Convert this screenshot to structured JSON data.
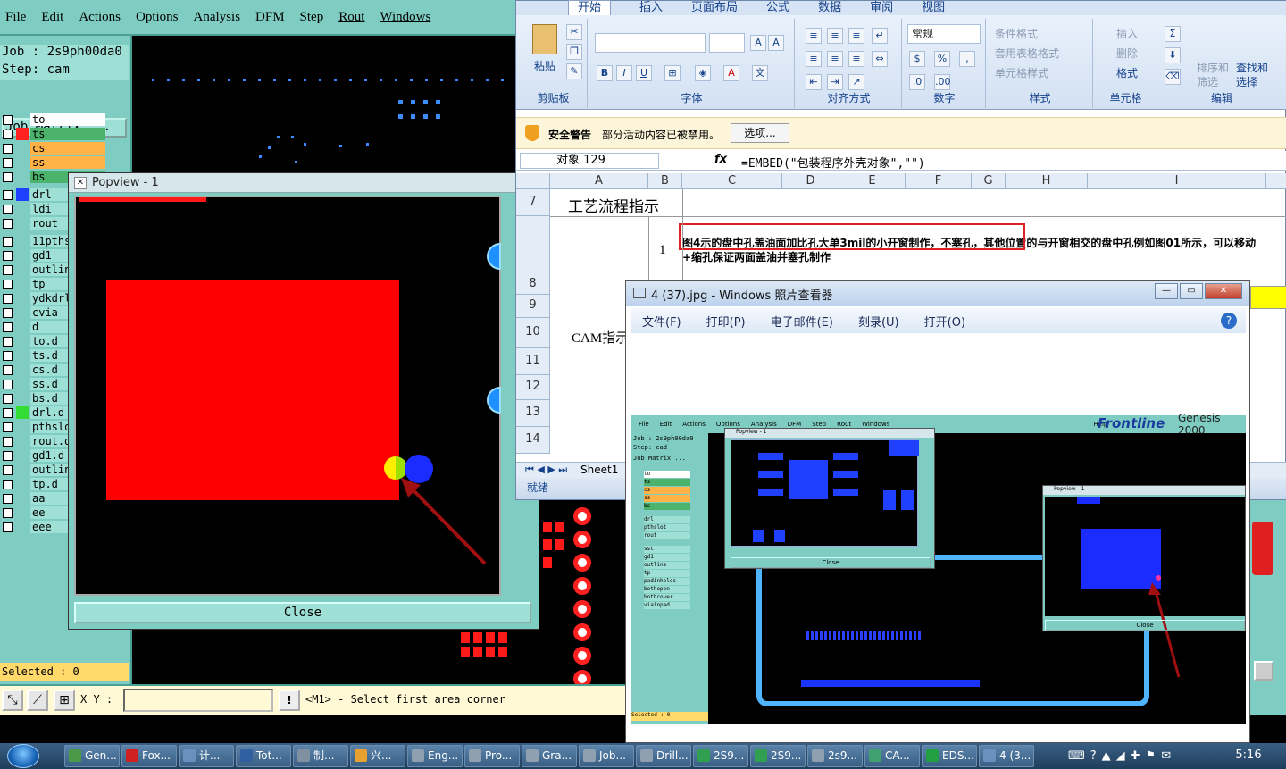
{
  "genesis": {
    "menu": [
      "File",
      "Edit",
      "Actions",
      "Options",
      "Analysis",
      "DFM",
      "Step",
      "Rout",
      "Windows"
    ],
    "job": "Job : 2s9ph00da0",
    "step": "Step: cam",
    "job_matrix": "Job Matrix ...",
    "layers": [
      {
        "name": "to",
        "color": "#ffffff",
        "swatch": ""
      },
      {
        "name": "ts",
        "color": "#4bb36b",
        "swatch": "#ff2020"
      },
      {
        "name": "cs",
        "color": "#ffb347",
        "swatch": ""
      },
      {
        "name": "ss",
        "color": "#ffb347",
        "swatch": ""
      },
      {
        "name": "bs",
        "color": "#4bb36b",
        "swatch": ""
      },
      {
        "name": "drl",
        "color": "#9fe0d6",
        "swatch": "#2040ff"
      },
      {
        "name": "ldi",
        "color": "#9fe0d6",
        "swatch": ""
      },
      {
        "name": "rout",
        "color": "#9fe0d6",
        "swatch": ""
      },
      {
        "name": "11pths",
        "color": "#9fe0d6",
        "swatch": ""
      },
      {
        "name": "gd1",
        "color": "#9fe0d6",
        "swatch": ""
      },
      {
        "name": "outlin",
        "color": "#9fe0d6",
        "swatch": ""
      },
      {
        "name": "tp",
        "color": "#9fe0d6",
        "swatch": ""
      },
      {
        "name": "ydkdrl",
        "color": "#9fe0d6",
        "swatch": ""
      },
      {
        "name": "cvia",
        "color": "#9fe0d6",
        "swatch": ""
      },
      {
        "name": "d",
        "color": "#9fe0d6",
        "swatch": ""
      },
      {
        "name": "to.d",
        "color": "#9fe0d6",
        "swatch": ""
      },
      {
        "name": "ts.d",
        "color": "#9fe0d6",
        "swatch": ""
      },
      {
        "name": "cs.d",
        "color": "#9fe0d6",
        "swatch": ""
      },
      {
        "name": "ss.d",
        "color": "#9fe0d6",
        "swatch": ""
      },
      {
        "name": "bs.d",
        "color": "#9fe0d6",
        "swatch": ""
      },
      {
        "name": "drl.d",
        "color": "#9fe0d6",
        "swatch": "#33dd33"
      },
      {
        "name": "pthslo",
        "color": "#9fe0d6",
        "swatch": ""
      },
      {
        "name": "rout.d",
        "color": "#9fe0d6",
        "swatch": ""
      },
      {
        "name": "gd1.d",
        "color": "#9fe0d6",
        "swatch": ""
      },
      {
        "name": "outlin",
        "color": "#9fe0d6",
        "swatch": ""
      },
      {
        "name": "tp.d",
        "color": "#9fe0d6",
        "swatch": ""
      },
      {
        "name": "aa",
        "color": "#9fe0d6",
        "swatch": ""
      },
      {
        "name": "ee",
        "color": "#9fe0d6",
        "swatch": ""
      },
      {
        "name": "eee",
        "color": "#9fe0d6",
        "swatch": ""
      }
    ],
    "selected": "Selected : 0",
    "xy_label": "X Y :",
    "xy_value": "",
    "prompt": "<M1> - Select first area corner"
  },
  "popview": {
    "title": "Popview - 1",
    "close": "Close"
  },
  "excel": {
    "tabs": [
      "开始",
      "插入",
      "页面布局",
      "公式",
      "数据",
      "审阅",
      "视图"
    ],
    "groups": {
      "clipboard": "剪贴板",
      "paste": "粘贴",
      "font": "字体",
      "align": "对齐方式",
      "number": "数字",
      "number_format": "常规",
      "styles": "样式",
      "cond_format": "条件格式",
      "table_format": "套用表格格式",
      "cell_style": "单元格样式",
      "cells": "单元格",
      "insert": "插入",
      "delete": "删除",
      "format": "格式",
      "editing": "编辑",
      "sort": "排序和",
      "filter": "筛选",
      "find": "查找和",
      "select": "选择"
    },
    "security_title": "安全警告",
    "security_msg": "部分活动内容已被禁用。",
    "options_btn": "选项...",
    "name_box": "对象 129",
    "formula": "=EMBED(\"包装程序外壳对象\",\"\")",
    "columns": [
      "A",
      "B",
      "C",
      "D",
      "E",
      "F",
      "G",
      "H",
      "I"
    ],
    "rows": [
      "7",
      "8",
      "9",
      "10",
      "11",
      "12",
      "13",
      "14"
    ],
    "cell_a7": "工艺流程指示",
    "cell_b8": "1",
    "cell_c8": "图4示的盘中孔盖油面加比孔大单3mil的小开窗制作，不塞孔，其他位置的与开窗相交的盘中孔例如图01所示，可以移动+缩孔保证两面盖油并塞孔制作",
    "cell_a10": "CAM指示",
    "sheet": "Sheet1",
    "status": "就绪"
  },
  "viewer": {
    "title": "4 (37).jpg - Windows 照片查看器",
    "menu": [
      "文件(F)",
      "打印(P)",
      "电子邮件(E)",
      "刻录(U)",
      "打开(O)"
    ],
    "inner_menu": [
      "File",
      "Edit",
      "Actions",
      "Options",
      "Analysis",
      "DFM",
      "Step",
      "Rout",
      "Windows",
      "Help"
    ],
    "brand": "Frontline",
    "brand2": "Genesis 2000",
    "inner_job": "Job : 2s9ph00da0",
    "inner_step": "Step: cad",
    "inner_matrix": "Job Matrix ...",
    "inner_layers": [
      "to",
      "ts",
      "cs",
      "ss",
      "bs",
      "drl",
      "pthslot",
      "rout",
      "sst",
      "gd1",
      "outline",
      "tp",
      "padinholes",
      "bothopen",
      "bothcover",
      "viainpad"
    ],
    "inner_pop1": "Popview - 1",
    "inner_pop2": "Popview - 1",
    "inner_close": "Close",
    "inner_selected": "Selected : 0"
  },
  "taskbar": {
    "items": [
      "Gen...",
      "Fox...",
      "计...",
      "Tot...",
      "制...",
      "兴...",
      "Eng...",
      "Pro...",
      "Gra...",
      "Job...",
      "Drill...",
      "2S9...",
      "2S9...",
      "2s9...",
      "CA...",
      "EDS...",
      "4 (3..."
    ],
    "clock": "5:16"
  }
}
